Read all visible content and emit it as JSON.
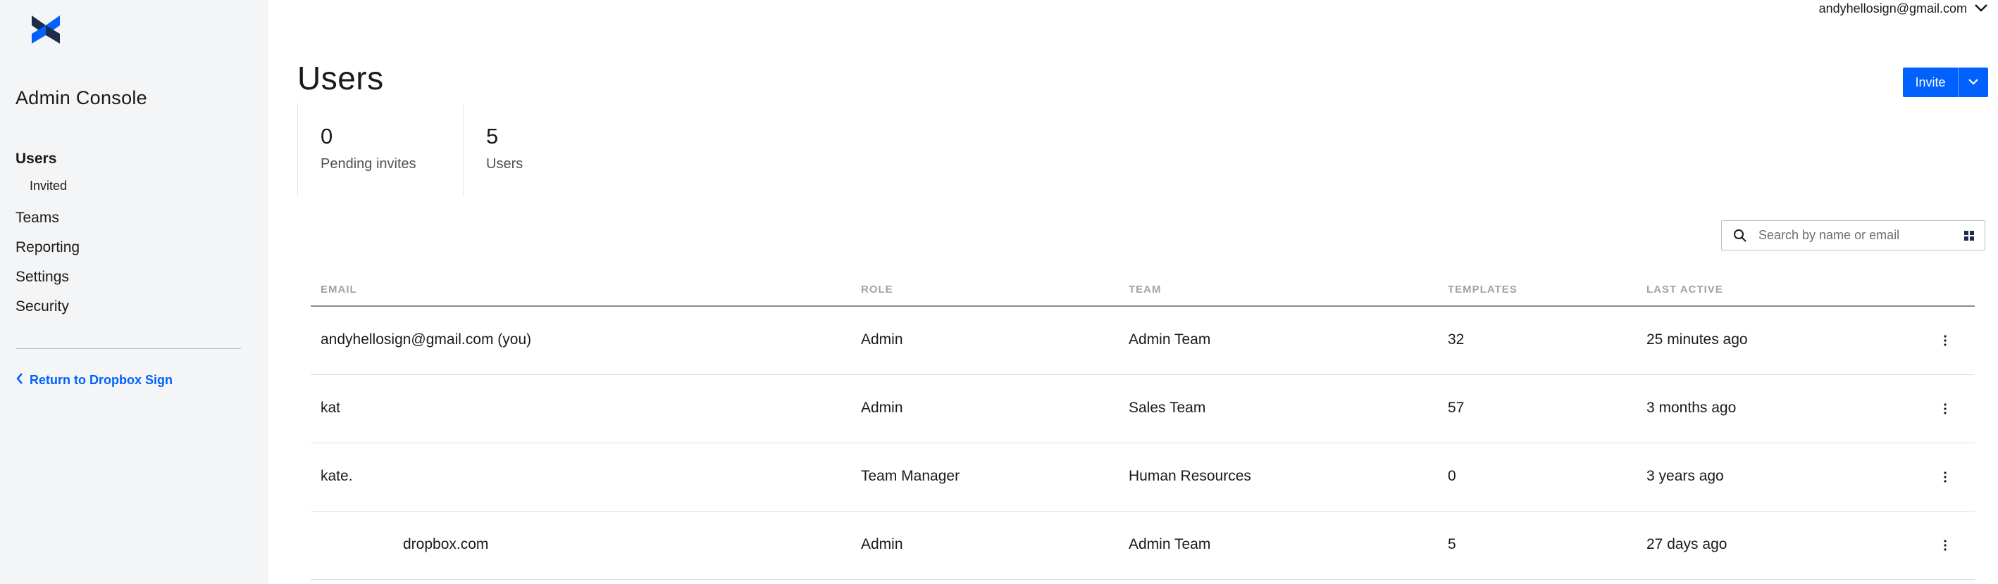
{
  "sidebar": {
    "title": "Admin Console",
    "items": [
      {
        "label": "Users",
        "active": true
      },
      {
        "label": "Invited",
        "sub": true
      },
      {
        "label": "Teams"
      },
      {
        "label": "Reporting"
      },
      {
        "label": "Settings"
      },
      {
        "label": "Security"
      }
    ],
    "return_label": "Return to Dropbox Sign"
  },
  "header": {
    "account": "andyhellosign@gmail.com",
    "title": "Users",
    "invite_label": "Invite"
  },
  "stats": [
    {
      "value": "0",
      "label": "Pending invites"
    },
    {
      "value": "5",
      "label": "Users"
    }
  ],
  "search": {
    "placeholder": "Search by name or email"
  },
  "table": {
    "columns": [
      "EMAIL",
      "ROLE",
      "TEAM",
      "TEMPLATES",
      "LAST ACTIVE"
    ],
    "rows": [
      {
        "email": "andyhellosign@gmail.com (you)",
        "role": "Admin",
        "team": "Admin Team",
        "templates": "32",
        "last_active": "25 minutes ago"
      },
      {
        "email": "kat",
        "role": "Admin",
        "team": "Sales Team",
        "templates": "57",
        "last_active": "3 months ago"
      },
      {
        "email": "kate.",
        "role": "Team Manager",
        "team": "Human Resources",
        "templates": "0",
        "last_active": "3 years ago"
      },
      {
        "email": "dropbox.com",
        "role": "Admin",
        "team": "Admin Team",
        "templates": "5",
        "last_active": "27 days ago"
      }
    ]
  },
  "colors": {
    "accent": "#0061fe",
    "sidebar_bg": "#f4f5f6",
    "logo_dark": "#1e2b4a",
    "logo_blue": "#0061fe"
  },
  "icons": [
    "logo-icon",
    "chevron-down-icon",
    "chevron-left-icon",
    "search-icon",
    "filter-icon",
    "kebab-menu-icon"
  ]
}
